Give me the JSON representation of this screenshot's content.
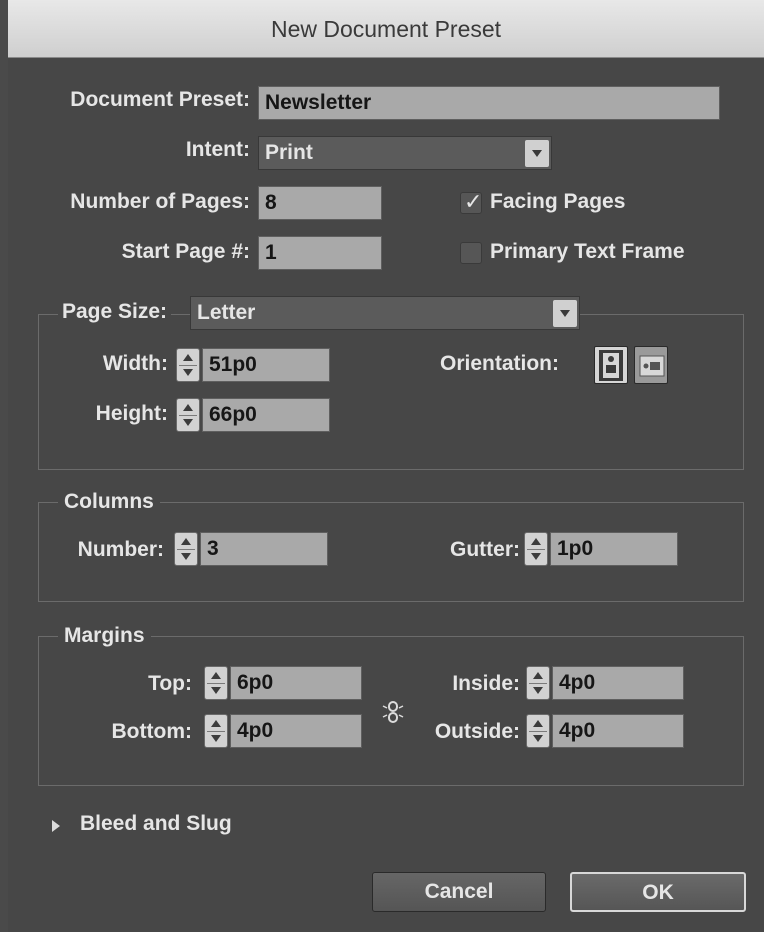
{
  "window": {
    "title": "New Document Preset"
  },
  "preset": {
    "label": "Document Preset:",
    "value": "Newsletter"
  },
  "intent": {
    "label": "Intent:",
    "value": "Print"
  },
  "pages": {
    "number_label": "Number of Pages:",
    "number_value": "8",
    "start_label": "Start Page #:",
    "start_value": "1",
    "facing_label": "Facing Pages",
    "facing_checked": true,
    "primary_label": "Primary Text Frame",
    "primary_checked": false
  },
  "page_size": {
    "label": "Page Size:",
    "value": "Letter",
    "width_label": "Width:",
    "width_value": "51p0",
    "height_label": "Height:",
    "height_value": "66p0",
    "orientation_label": "Orientation:",
    "orientation_selected": "portrait"
  },
  "columns": {
    "legend": "Columns",
    "number_label": "Number:",
    "number_value": "3",
    "gutter_label": "Gutter:",
    "gutter_value": "1p0"
  },
  "margins": {
    "legend": "Margins",
    "top_label": "Top:",
    "top_value": "6p0",
    "bottom_label": "Bottom:",
    "bottom_value": "4p0",
    "inside_label": "Inside:",
    "inside_value": "4p0",
    "outside_label": "Outside:",
    "outside_value": "4p0"
  },
  "bleed": {
    "label": "Bleed and Slug"
  },
  "buttons": {
    "cancel": "Cancel",
    "ok": "OK"
  },
  "colors": {
    "background": "#474747",
    "field": "#a9a9a9",
    "titlebar": "#dadada"
  }
}
